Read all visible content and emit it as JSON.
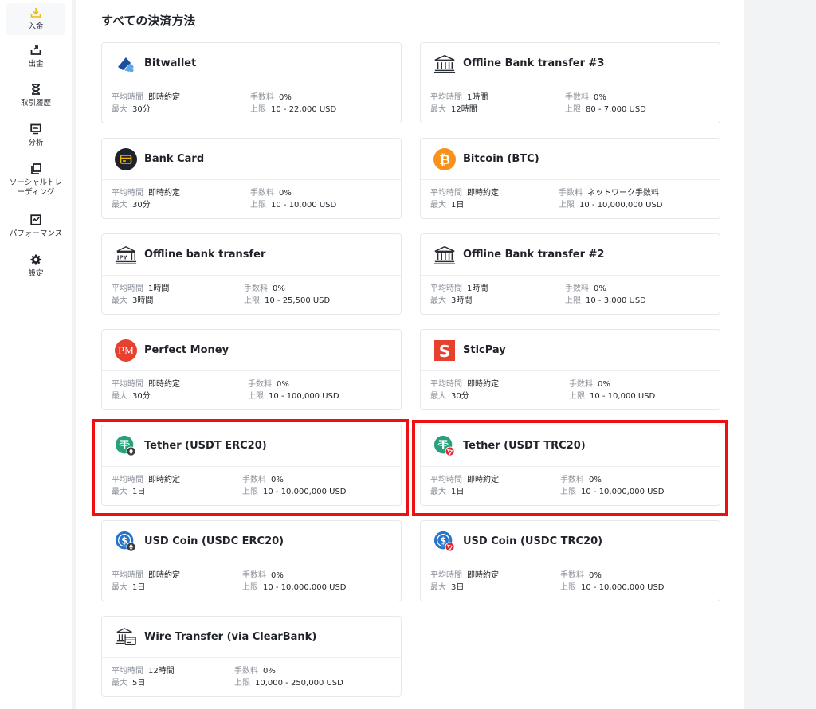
{
  "sidebar": {
    "items": [
      {
        "label": "入金",
        "icon": "download-icon",
        "active": true
      },
      {
        "label": "出金",
        "icon": "upload-icon"
      },
      {
        "label": "取引履歴",
        "icon": "hourglass-icon"
      },
      {
        "label": "分析",
        "icon": "chart-monitor-icon"
      },
      {
        "label": "ソーシャルトレーディング",
        "line1": "ソーシャルトレ",
        "line2": "ーディング",
        "icon": "copy-icon"
      },
      {
        "label": "パフォーマンス",
        "icon": "performance-icon"
      },
      {
        "label": "設定",
        "icon": "gear-icon"
      }
    ]
  },
  "page": {
    "title": "すべての決済方法"
  },
  "labels": {
    "avg_time": "平均時間",
    "max": "最大",
    "fee": "手数料",
    "limit": "上限"
  },
  "methods": [
    {
      "name": "Bitwallet",
      "icon": "bitwallet-icon",
      "avg_time": "即時約定",
      "max": "30分",
      "fee": "0%",
      "limit": "10 - 22,000 USD"
    },
    {
      "name": "Offline Bank transfer #3",
      "icon": "bank-building-icon",
      "avg_time": "1時間",
      "max": "12時間",
      "fee": "0%",
      "limit": "80 - 7,000 USD"
    },
    {
      "name": "Bank Card",
      "icon": "bank-card-icon",
      "avg_time": "即時約定",
      "max": "30分",
      "fee": "0%",
      "limit": "10 - 10,000 USD"
    },
    {
      "name": "Bitcoin (BTC)",
      "icon": "bitcoin-icon",
      "avg_time": "即時約定",
      "max": "1日",
      "fee": "ネットワーク手数料",
      "limit": "10 - 10,000,000 USD"
    },
    {
      "name": "Offline bank transfer",
      "icon": "jpy-bank-icon",
      "avg_time": "1時間",
      "max": "3時間",
      "fee": "0%",
      "limit": "10 - 25,500 USD",
      "icon_text": "JPY"
    },
    {
      "name": "Offline Bank transfer #2",
      "icon": "bank-building-icon",
      "avg_time": "1時間",
      "max": "3時間",
      "fee": "0%",
      "limit": "10 - 3,000 USD"
    },
    {
      "name": "Perfect Money",
      "icon": "perfect-money-icon",
      "avg_time": "即時約定",
      "max": "30分",
      "fee": "0%",
      "limit": "10 - 100,000 USD",
      "icon_text": "PM"
    },
    {
      "name": "SticPay",
      "icon": "sticpay-icon",
      "avg_time": "即時約定",
      "max": "30分",
      "fee": "0%",
      "limit": "10 - 10,000 USD",
      "icon_text": "S"
    },
    {
      "name": "Tether (USDT ERC20)",
      "icon": "tether-erc20-icon",
      "avg_time": "即時約定",
      "max": "1日",
      "fee": "0%",
      "limit": "10 - 10,000,000 USD"
    },
    {
      "name": "Tether (USDT TRC20)",
      "icon": "tether-trc20-icon",
      "avg_time": "即時約定",
      "max": "1日",
      "fee": "0%",
      "limit": "10 - 10,000,000 USD"
    },
    {
      "name": "USD Coin (USDC ERC20)",
      "icon": "usdc-erc20-icon",
      "avg_time": "即時約定",
      "max": "1日",
      "fee": "0%",
      "limit": "10 - 10,000,000 USD"
    },
    {
      "name": "USD Coin (USDC TRC20)",
      "icon": "usdc-trc20-icon",
      "avg_time": "即時約定",
      "max": "3日",
      "fee": "0%",
      "limit": "10 - 10,000,000 USD"
    },
    {
      "name": "Wire Transfer (via ClearBank)",
      "icon": "wire-transfer-icon",
      "avg_time": "12時間",
      "max": "5日",
      "fee": "0%",
      "limit": "10,000 - 250,000 USD"
    }
  ],
  "colors": {
    "accent": "#f0b90b",
    "highlight": "#ee1010",
    "tether": "#26a17b",
    "usdc": "#2775ca",
    "bitcoin": "#f7931a",
    "tron": "#e5262e"
  }
}
